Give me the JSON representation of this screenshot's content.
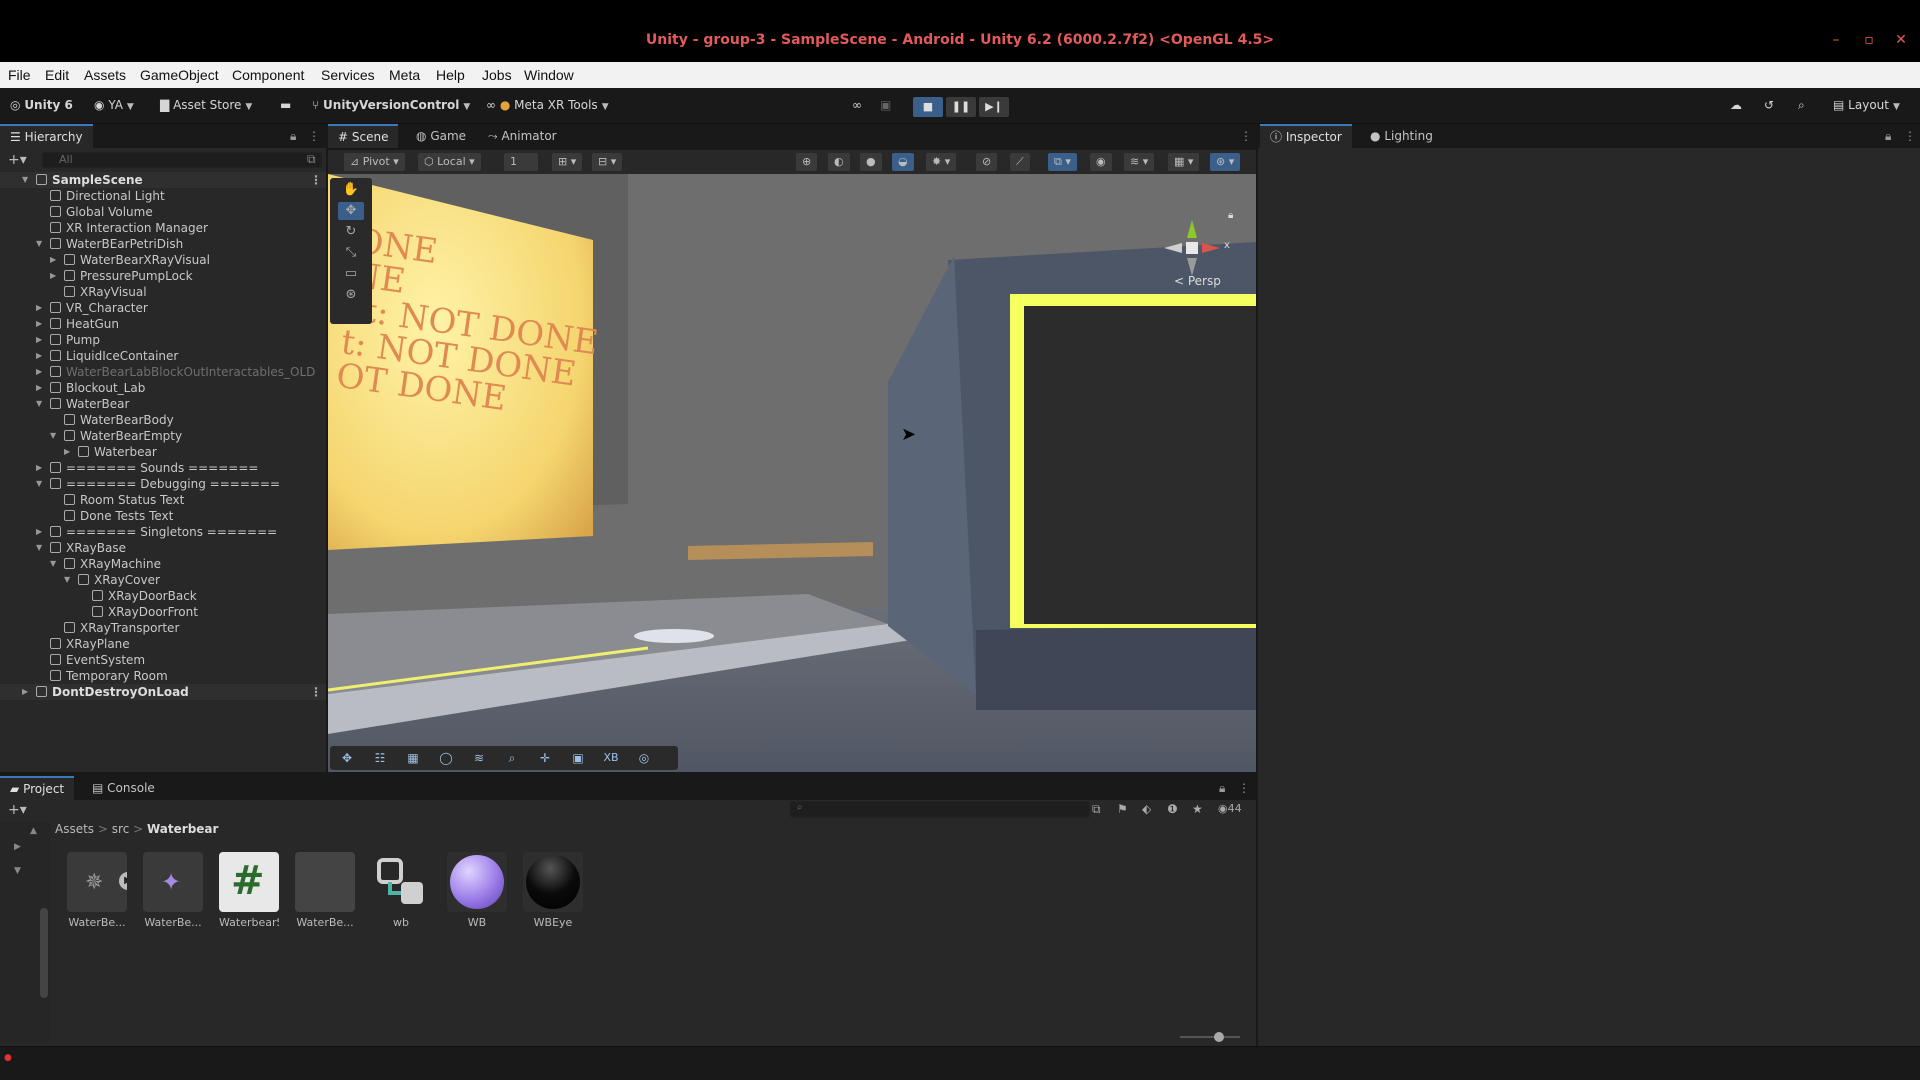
{
  "window": {
    "title": "Unity - group-3 - SampleScene - Android - Unity 6.2 (6000.2.7f2) <OpenGL 4.5>",
    "minimize": "–",
    "maximize": "▫",
    "close": "✕"
  },
  "menu": [
    "File",
    "Edit",
    "Assets",
    "GameObject",
    "Component",
    "Services",
    "Meta",
    "Help",
    "Jobs",
    "Window"
  ],
  "toolbar": {
    "unity_label": "Unity 6",
    "account": "YA",
    "asset_store": "Asset Store",
    "version_control": "UnityVersionControl",
    "meta_tools": "Meta XR Tools",
    "layout": "Layout"
  },
  "hierarchy": {
    "tab": "Hierarchy",
    "search_placeholder": "All",
    "rows": [
      {
        "label": "SampleScene",
        "depth": 0,
        "arrow": "▼",
        "type": "scene"
      },
      {
        "label": "Directional Light",
        "depth": 1,
        "arrow": ""
      },
      {
        "label": "Global Volume",
        "depth": 1,
        "arrow": ""
      },
      {
        "label": "XR Interaction Manager",
        "depth": 1,
        "arrow": ""
      },
      {
        "label": "WaterBEarPetriDish",
        "depth": 1,
        "arrow": "▼"
      },
      {
        "label": "WaterBearXRayVisual",
        "depth": 2,
        "arrow": "▶"
      },
      {
        "label": "PressurePumpLock",
        "depth": 2,
        "arrow": "▶"
      },
      {
        "label": "XRayVisual",
        "depth": 2,
        "arrow": ""
      },
      {
        "label": "VR_Character",
        "depth": 1,
        "arrow": "▶"
      },
      {
        "label": "HeatGun",
        "depth": 1,
        "arrow": "▶"
      },
      {
        "label": "Pump",
        "depth": 1,
        "arrow": "▶"
      },
      {
        "label": "LiquidIceContainer",
        "depth": 1,
        "arrow": "▶"
      },
      {
        "label": "WaterBearLabBlockOutInteractables_OLD",
        "depth": 1,
        "arrow": "▶",
        "type": "dim"
      },
      {
        "label": "Blockout_Lab",
        "depth": 1,
        "arrow": "▶"
      },
      {
        "label": "WaterBear",
        "depth": 1,
        "arrow": "▼"
      },
      {
        "label": "WaterBearBody",
        "depth": 2,
        "arrow": ""
      },
      {
        "label": "WaterBearEmpty",
        "depth": 2,
        "arrow": "▼"
      },
      {
        "label": "Waterbear",
        "depth": 3,
        "arrow": "▶"
      },
      {
        "label": "======= Sounds =======",
        "depth": 1,
        "arrow": "▶"
      },
      {
        "label": "======= Debugging =======",
        "depth": 1,
        "arrow": "▼"
      },
      {
        "label": "Room Status Text",
        "depth": 2,
        "arrow": ""
      },
      {
        "label": "Done Tests Text",
        "depth": 2,
        "arrow": ""
      },
      {
        "label": "======= Singletons =======",
        "depth": 1,
        "arrow": "▶"
      },
      {
        "label": "XRayBase",
        "depth": 1,
        "arrow": "▼"
      },
      {
        "label": "XRayMachine",
        "depth": 2,
        "arrow": "▼"
      },
      {
        "label": "XRayCover",
        "depth": 3,
        "arrow": "▼"
      },
      {
        "label": "XRayDoorBack",
        "depth": 4,
        "arrow": ""
      },
      {
        "label": "XRayDoorFront",
        "depth": 4,
        "arrow": ""
      },
      {
        "label": "XRayTransporter",
        "depth": 2,
        "arrow": ""
      },
      {
        "label": "XRayPlane",
        "depth": 1,
        "arrow": ""
      },
      {
        "label": "EventSystem",
        "depth": 1,
        "arrow": ""
      },
      {
        "label": "Temporary Room",
        "depth": 1,
        "arrow": ""
      },
      {
        "label": "DontDestroyOnLoad",
        "depth": 0,
        "arrow": "▶",
        "type": "scene"
      }
    ]
  },
  "scene_tabs": [
    "Scene",
    "Game",
    "Animator"
  ],
  "scene_toolbar": {
    "pivot": "Pivot",
    "local": "Local",
    "grid_value": "1"
  },
  "viewport": {
    "sign_lines": [
      "ONE",
      "NE",
      "st: NOT DONE",
      "t: NOT DONE",
      "OT DONE"
    ],
    "persp_label": "< Persp",
    "gizmo_x": "x"
  },
  "bottom_tools_labels": [
    "XB"
  ],
  "right_tabs": [
    "Inspector",
    "Lighting"
  ],
  "project": {
    "tabs": [
      "Project",
      "Console"
    ],
    "breadcrumb": [
      "Assets",
      "src",
      "Waterbear"
    ],
    "count": "44",
    "assets": [
      {
        "name": "WaterBe...",
        "kind": "model"
      },
      {
        "name": "WaterBe...",
        "kind": "prefab"
      },
      {
        "name": "WaterbearS...",
        "kind": "script"
      },
      {
        "name": "WaterBe...",
        "kind": "blank"
      },
      {
        "name": "wb",
        "kind": "animator"
      },
      {
        "name": "WB",
        "kind": "material-purple"
      },
      {
        "name": "WBEye",
        "kind": "material-black"
      }
    ]
  },
  "colors": {
    "accent": "#3a79bb",
    "title_red": "#e35a5a",
    "sign_yellow": "#f3d36a",
    "frame_glow": "#f7ff5a"
  }
}
